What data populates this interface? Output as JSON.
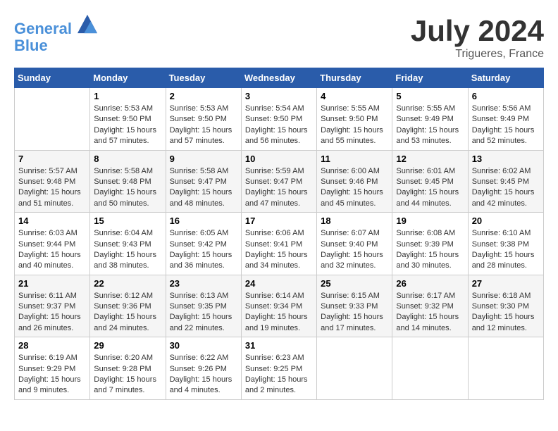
{
  "header": {
    "logo_line1": "General",
    "logo_line2": "Blue",
    "month": "July 2024",
    "location": "Trigueres, France"
  },
  "weekdays": [
    "Sunday",
    "Monday",
    "Tuesday",
    "Wednesday",
    "Thursday",
    "Friday",
    "Saturday"
  ],
  "weeks": [
    [
      {
        "day": "",
        "info": ""
      },
      {
        "day": "1",
        "info": "Sunrise: 5:53 AM\nSunset: 9:50 PM\nDaylight: 15 hours\nand 57 minutes."
      },
      {
        "day": "2",
        "info": "Sunrise: 5:53 AM\nSunset: 9:50 PM\nDaylight: 15 hours\nand 57 minutes."
      },
      {
        "day": "3",
        "info": "Sunrise: 5:54 AM\nSunset: 9:50 PM\nDaylight: 15 hours\nand 56 minutes."
      },
      {
        "day": "4",
        "info": "Sunrise: 5:55 AM\nSunset: 9:50 PM\nDaylight: 15 hours\nand 55 minutes."
      },
      {
        "day": "5",
        "info": "Sunrise: 5:55 AM\nSunset: 9:49 PM\nDaylight: 15 hours\nand 53 minutes."
      },
      {
        "day": "6",
        "info": "Sunrise: 5:56 AM\nSunset: 9:49 PM\nDaylight: 15 hours\nand 52 minutes."
      }
    ],
    [
      {
        "day": "7",
        "info": "Sunrise: 5:57 AM\nSunset: 9:48 PM\nDaylight: 15 hours\nand 51 minutes."
      },
      {
        "day": "8",
        "info": "Sunrise: 5:58 AM\nSunset: 9:48 PM\nDaylight: 15 hours\nand 50 minutes."
      },
      {
        "day": "9",
        "info": "Sunrise: 5:58 AM\nSunset: 9:47 PM\nDaylight: 15 hours\nand 48 minutes."
      },
      {
        "day": "10",
        "info": "Sunrise: 5:59 AM\nSunset: 9:47 PM\nDaylight: 15 hours\nand 47 minutes."
      },
      {
        "day": "11",
        "info": "Sunrise: 6:00 AM\nSunset: 9:46 PM\nDaylight: 15 hours\nand 45 minutes."
      },
      {
        "day": "12",
        "info": "Sunrise: 6:01 AM\nSunset: 9:45 PM\nDaylight: 15 hours\nand 44 minutes."
      },
      {
        "day": "13",
        "info": "Sunrise: 6:02 AM\nSunset: 9:45 PM\nDaylight: 15 hours\nand 42 minutes."
      }
    ],
    [
      {
        "day": "14",
        "info": "Sunrise: 6:03 AM\nSunset: 9:44 PM\nDaylight: 15 hours\nand 40 minutes."
      },
      {
        "day": "15",
        "info": "Sunrise: 6:04 AM\nSunset: 9:43 PM\nDaylight: 15 hours\nand 38 minutes."
      },
      {
        "day": "16",
        "info": "Sunrise: 6:05 AM\nSunset: 9:42 PM\nDaylight: 15 hours\nand 36 minutes."
      },
      {
        "day": "17",
        "info": "Sunrise: 6:06 AM\nSunset: 9:41 PM\nDaylight: 15 hours\nand 34 minutes."
      },
      {
        "day": "18",
        "info": "Sunrise: 6:07 AM\nSunset: 9:40 PM\nDaylight: 15 hours\nand 32 minutes."
      },
      {
        "day": "19",
        "info": "Sunrise: 6:08 AM\nSunset: 9:39 PM\nDaylight: 15 hours\nand 30 minutes."
      },
      {
        "day": "20",
        "info": "Sunrise: 6:10 AM\nSunset: 9:38 PM\nDaylight: 15 hours\nand 28 minutes."
      }
    ],
    [
      {
        "day": "21",
        "info": "Sunrise: 6:11 AM\nSunset: 9:37 PM\nDaylight: 15 hours\nand 26 minutes."
      },
      {
        "day": "22",
        "info": "Sunrise: 6:12 AM\nSunset: 9:36 PM\nDaylight: 15 hours\nand 24 minutes."
      },
      {
        "day": "23",
        "info": "Sunrise: 6:13 AM\nSunset: 9:35 PM\nDaylight: 15 hours\nand 22 minutes."
      },
      {
        "day": "24",
        "info": "Sunrise: 6:14 AM\nSunset: 9:34 PM\nDaylight: 15 hours\nand 19 minutes."
      },
      {
        "day": "25",
        "info": "Sunrise: 6:15 AM\nSunset: 9:33 PM\nDaylight: 15 hours\nand 17 minutes."
      },
      {
        "day": "26",
        "info": "Sunrise: 6:17 AM\nSunset: 9:32 PM\nDaylight: 15 hours\nand 14 minutes."
      },
      {
        "day": "27",
        "info": "Sunrise: 6:18 AM\nSunset: 9:30 PM\nDaylight: 15 hours\nand 12 minutes."
      }
    ],
    [
      {
        "day": "28",
        "info": "Sunrise: 6:19 AM\nSunset: 9:29 PM\nDaylight: 15 hours\nand 9 minutes."
      },
      {
        "day": "29",
        "info": "Sunrise: 6:20 AM\nSunset: 9:28 PM\nDaylight: 15 hours\nand 7 minutes."
      },
      {
        "day": "30",
        "info": "Sunrise: 6:22 AM\nSunset: 9:26 PM\nDaylight: 15 hours\nand 4 minutes."
      },
      {
        "day": "31",
        "info": "Sunrise: 6:23 AM\nSunset: 9:25 PM\nDaylight: 15 hours\nand 2 minutes."
      },
      {
        "day": "",
        "info": ""
      },
      {
        "day": "",
        "info": ""
      },
      {
        "day": "",
        "info": ""
      }
    ]
  ]
}
